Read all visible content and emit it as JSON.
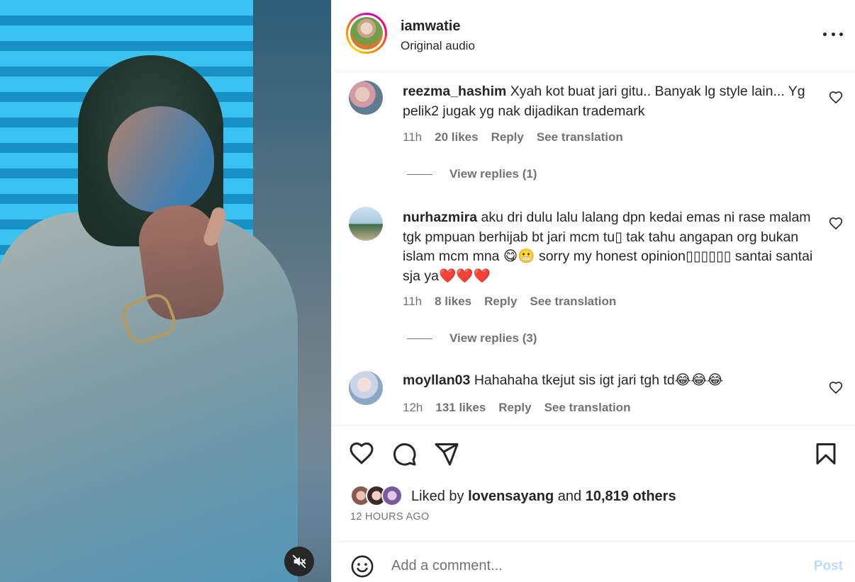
{
  "header": {
    "username": "iamwatie",
    "subtitle": "Original audio",
    "more_icon": "more-horizontal-icon"
  },
  "media": {
    "mute_icon": "speaker-muted-icon"
  },
  "comments": [
    {
      "username": "reezma_hashim",
      "text": "Xyah kot buat jari gitu.. Banyak lg style lain... Yg pelik2 jugak yg nak dijadikan trademark",
      "time": "11h",
      "likes": "20 likes",
      "reply": "Reply",
      "translate": "See translation",
      "view_replies": "View replies (1)"
    },
    {
      "username": "nurhazmira",
      "text": "aku dri dulu lalu lalang dpn kedai emas ni rase malam tgk pmpuan berhijab bt jari mcm tu▯ tak tahu angapan org bukan islam mcm mna 😋😬 sorry my honest opinion▯▯▯▯▯▯ santai santai sja ya❤️❤️❤️",
      "time": "11h",
      "likes": "8 likes",
      "reply": "Reply",
      "translate": "See translation",
      "view_replies": "View replies (3)"
    },
    {
      "username": "moyllan03",
      "text": "Hahahaha tkejut sis igt jari tgh td😂😂😂",
      "time": "12h",
      "likes": "131 likes",
      "reply": "Reply",
      "translate": "See translation"
    }
  ],
  "actions": {
    "like_icon": "heart-icon",
    "comment_icon": "comment-icon",
    "share_icon": "paper-plane-icon",
    "save_icon": "bookmark-icon",
    "liked_by_prefix": "Liked by",
    "liked_by_user": "lovensayang",
    "liked_by_and": "and",
    "liked_by_count": "10,819 others",
    "time_ago": "12 HOURS AGO"
  },
  "add_comment": {
    "placeholder": "Add a comment...",
    "post_label": "Post",
    "emoji_icon": "smiley-icon"
  },
  "colors": {
    "text": "#262626",
    "muted": "#737373",
    "post_disabled": "#b8dcfb",
    "border": "#efefef"
  }
}
